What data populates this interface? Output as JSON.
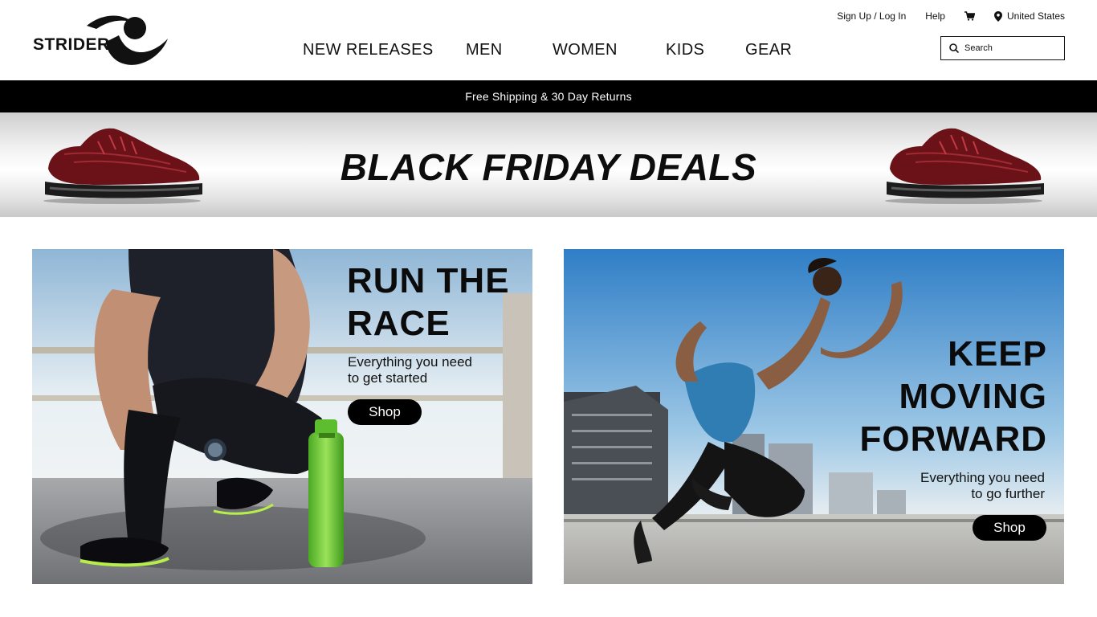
{
  "brand": {
    "name": "STRIDER"
  },
  "utility": {
    "signup": "Sign Up / Log In",
    "help": "Help",
    "region": "United States"
  },
  "nav": [
    "NEW RELEASES",
    "MEN",
    "WOMEN",
    "KIDS",
    "GEAR"
  ],
  "search": {
    "placeholder": "Search"
  },
  "shipbar": {
    "text": "Free Shipping & 30 Day Returns"
  },
  "banner": {
    "title": "BLACK FRIDAY DEALS"
  },
  "promos": {
    "left": {
      "line1": "RUN THE",
      "line2": "RACE",
      "sub1": "Everything you need",
      "sub2": "to get started",
      "button": "Shop"
    },
    "right": {
      "line1": "KEEP",
      "line2": "MOVING",
      "line3": "FORWARD",
      "sub1": "Everything you need",
      "sub2": "to go further",
      "button": "Shop"
    }
  },
  "icons": {
    "cart": "cart-icon",
    "location": "location-pin-icon",
    "search": "search-icon"
  },
  "colors": {
    "accent": "#000000",
    "shoe": "#7a1a1f"
  }
}
